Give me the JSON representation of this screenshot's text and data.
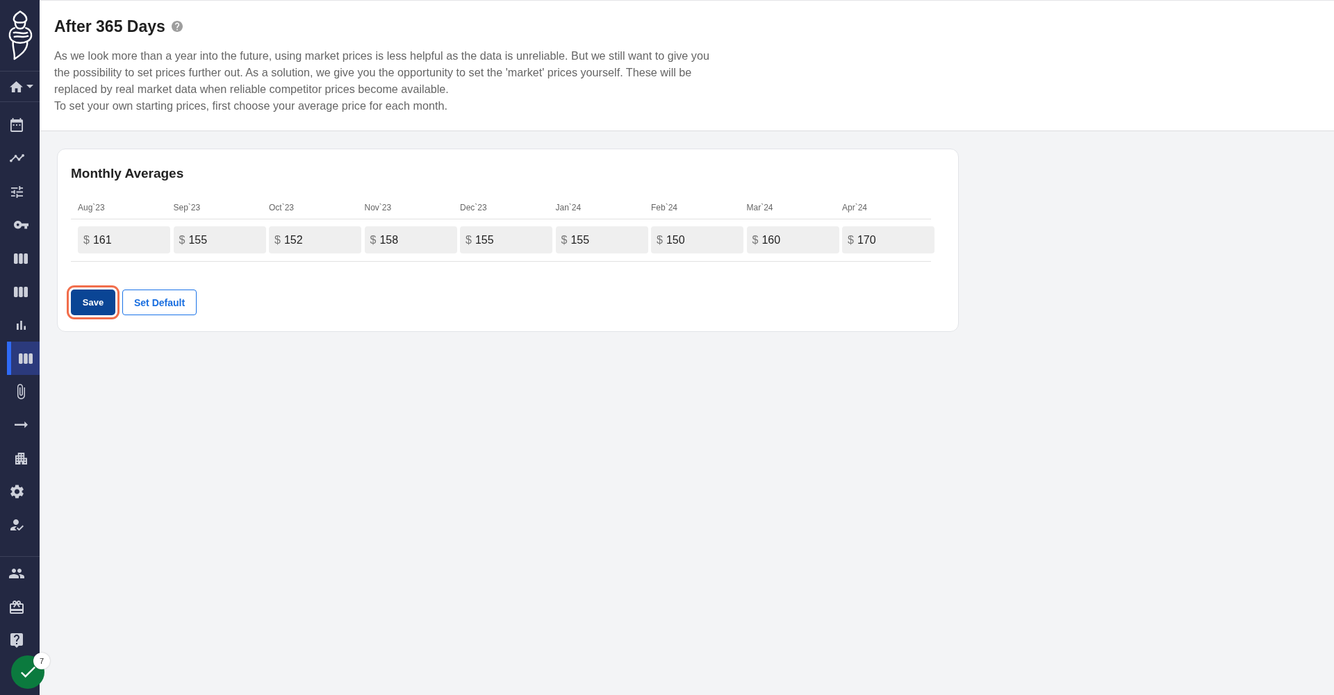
{
  "sidebar": {
    "items": [
      {
        "selected": false
      },
      {
        "selected": false
      },
      {
        "selected": false
      },
      {
        "selected": false
      },
      {
        "selected": false
      },
      {
        "selected": false
      },
      {
        "selected": false
      },
      {
        "selected": true
      },
      {
        "selected": false
      },
      {
        "selected": false
      },
      {
        "selected": false
      },
      {
        "selected": false
      },
      {
        "selected": false
      }
    ],
    "bottom_items": [
      {
        "selected": false
      },
      {
        "selected": false
      },
      {
        "selected": false
      }
    ]
  },
  "status_badge": {
    "count": "7"
  },
  "page_header": {
    "title": "After 365 Days",
    "description": [
      "As we look more than a year into the future, using market prices is less helpful as the data is unreliable. But we still want to give you the possibility to set prices further out. As a solution, we give you the opportunity to set the 'market' prices yourself. These will be replaced by real market data when reliable competitor prices become available.",
      "To set your own starting prices, first choose your average price for each month."
    ]
  },
  "monthly_averages": {
    "title": "Monthly Averages",
    "columns": [
      "Aug`23",
      "Sep`23",
      "Oct`23",
      "Nov`23",
      "Dec`23",
      "Jan`24",
      "Feb`24",
      "Mar`24",
      "Apr`24"
    ],
    "rows": [
      [
        {
          "currency": "$",
          "value": "161"
        },
        {
          "currency": "$",
          "value": "155"
        },
        {
          "currency": "$",
          "value": "152"
        },
        {
          "currency": "$",
          "value": "158"
        },
        {
          "currency": "$",
          "value": "155"
        },
        {
          "currency": "$",
          "value": "155"
        },
        {
          "currency": "$",
          "value": "150"
        },
        {
          "currency": "$",
          "value": "160"
        },
        {
          "currency": "$",
          "value": "170"
        }
      ]
    ]
  },
  "buttons": [
    {
      "label": "Save",
      "kind": "primary",
      "focused": true
    },
    {
      "label": "Set Default",
      "kind": "secondary",
      "focused": false
    }
  ]
}
